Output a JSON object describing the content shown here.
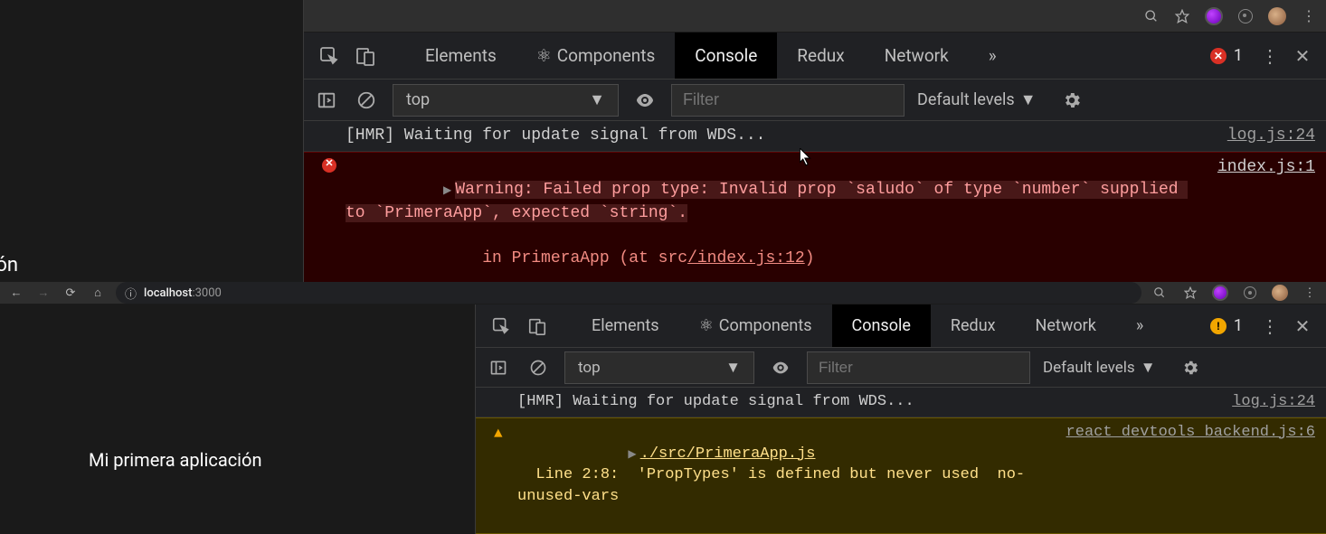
{
  "upper": {
    "tabs": {
      "elements": "Elements",
      "components": "Components",
      "console": "Console",
      "redux": "Redux",
      "network": "Network"
    },
    "error_count": "1",
    "sub": {
      "context": "top",
      "filter_placeholder": "Filter",
      "levels": "Default levels"
    },
    "log1": {
      "text": "[HMR] Waiting for update signal from WDS...",
      "src": "log.js:24"
    },
    "log2": {
      "text": "Warning: Failed prop type: Invalid prop `saludo` of type `number` supplied to `PrimeraApp`, expected `string`.",
      "trace_prefix": "    in PrimeraApp (at src",
      "trace_link": "/index.js:12",
      "trace_suffix": ")",
      "src": "index.js:1"
    },
    "truncated_left": "ión"
  },
  "lower": {
    "url_prefix": "localhost",
    "url_port": ":3000",
    "page_heading": "Mi primera aplicación",
    "tabs": {
      "elements": "Elements",
      "components": "Components",
      "console": "Console",
      "redux": "Redux",
      "network": "Network"
    },
    "warn_count": "1",
    "sub": {
      "context": "top",
      "filter_placeholder": "Filter",
      "levels": "Default levels"
    },
    "log1": {
      "text": "[HMR] Waiting for update signal from WDS...",
      "src": "log.js:24"
    },
    "log2": {
      "file": "./src/PrimeraApp.js",
      "detail": "  Line 2:8:  'PropTypes' is defined but never used  no-unused-vars",
      "src": "react_devtools_backend.js:6"
    }
  }
}
